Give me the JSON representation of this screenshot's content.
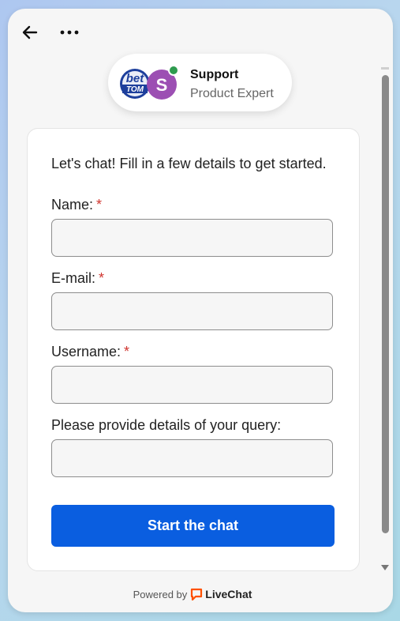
{
  "header": {
    "back_icon": "arrow-left-icon",
    "more_icon": "more-dots-icon"
  },
  "agent": {
    "logo_text_top": "bet",
    "logo_text_bottom": "TOM",
    "avatar_initial": "S",
    "name": "Support",
    "role": "Product Expert",
    "status_color": "#2e9b4f",
    "avatar_color": "#9c4fb3"
  },
  "form": {
    "intro": "Let's chat! Fill in a few details to get started.",
    "fields": [
      {
        "label": "Name:",
        "required": "*",
        "value": ""
      },
      {
        "label": "E-mail:",
        "required": "*",
        "value": ""
      },
      {
        "label": "Username:",
        "required": "*",
        "value": ""
      },
      {
        "label": "Please provide details of your query:",
        "required": "",
        "value": ""
      }
    ],
    "submit_label": "Start the chat",
    "accent": "#0a5ee0"
  },
  "footer": {
    "powered_by": "Powered by",
    "brand": "LiveChat",
    "brand_icon": "livechat-icon",
    "brand_color": "#ff5100"
  }
}
